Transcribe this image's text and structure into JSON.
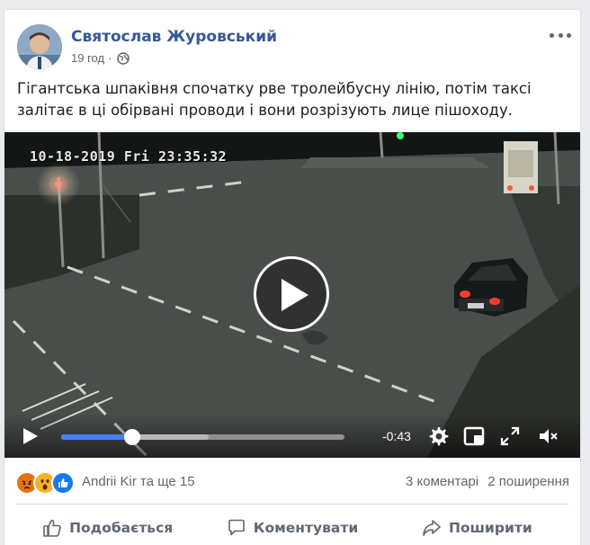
{
  "post": {
    "author": "Святослав Журовський",
    "time": "19 год",
    "time_separator": "·",
    "privacy_icon": "globe-icon",
    "menu_icon": "more-options-icon",
    "text": "Гігантська шпаківня спочатку рве тролейбусну лінію, потім таксі залітає в ці обірвані проводи і вони розрізують лице пішоходу."
  },
  "video": {
    "overlay_timestamp": "10-18-2019 Fri 23:35:32",
    "progress": 0.25,
    "buffered": 0.52,
    "time_remaining": "-0:43",
    "play_icon": "play-icon",
    "settings_icon": "gear-icon",
    "pip_icon": "pip-icon",
    "fullscreen_icon": "fullscreen-icon",
    "mute_icon": "volume-muted-icon"
  },
  "reactions": {
    "icons": [
      "angry",
      "wow",
      "like"
    ],
    "names": "Andrii Kir та ще 15",
    "comments": "3 коментарі",
    "shares": "2 поширення",
    "colors": {
      "angry": "#e9710f",
      "wow": "#f7b125",
      "like": "#1877f2"
    }
  },
  "actions": {
    "like": "Подобається",
    "comment": "Коментувати",
    "share": "Поширити"
  },
  "colors": {
    "author_link": "#365899",
    "progress": "#4080ff",
    "secondary_text": "#606770"
  }
}
